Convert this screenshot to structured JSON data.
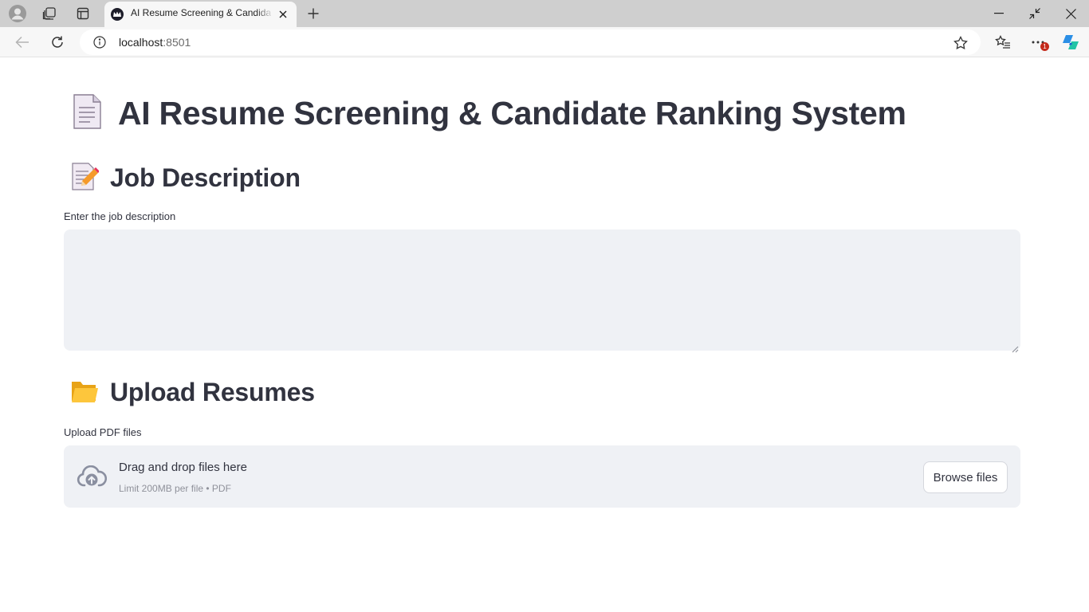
{
  "browser": {
    "tab_title": "AI Resume Screening & Candidate Ranking System",
    "url_host": "localhost",
    "url_port": ":8501",
    "extensions_badge": "1"
  },
  "page": {
    "title": "AI Resume Screening & Candidate Ranking System",
    "title_icon": "page-document-emoji",
    "job_section": {
      "heading": "Job Description",
      "icon": "memo-pencil-emoji",
      "input_label": "Enter the job description",
      "input_value": ""
    },
    "upload_section": {
      "heading": "Upload Resumes",
      "icon": "open-folder-emoji",
      "input_label": "Upload PDF files",
      "dropzone_text": "Drag and drop files here",
      "dropzone_hint": "Limit 200MB per file • PDF",
      "browse_label": "Browse files"
    }
  },
  "colors": {
    "text": "#31333f",
    "input_bg": "#eff1f5",
    "chrome_tabbar": "#cfcfcf",
    "chrome_toolbar": "#f7f7f7"
  }
}
